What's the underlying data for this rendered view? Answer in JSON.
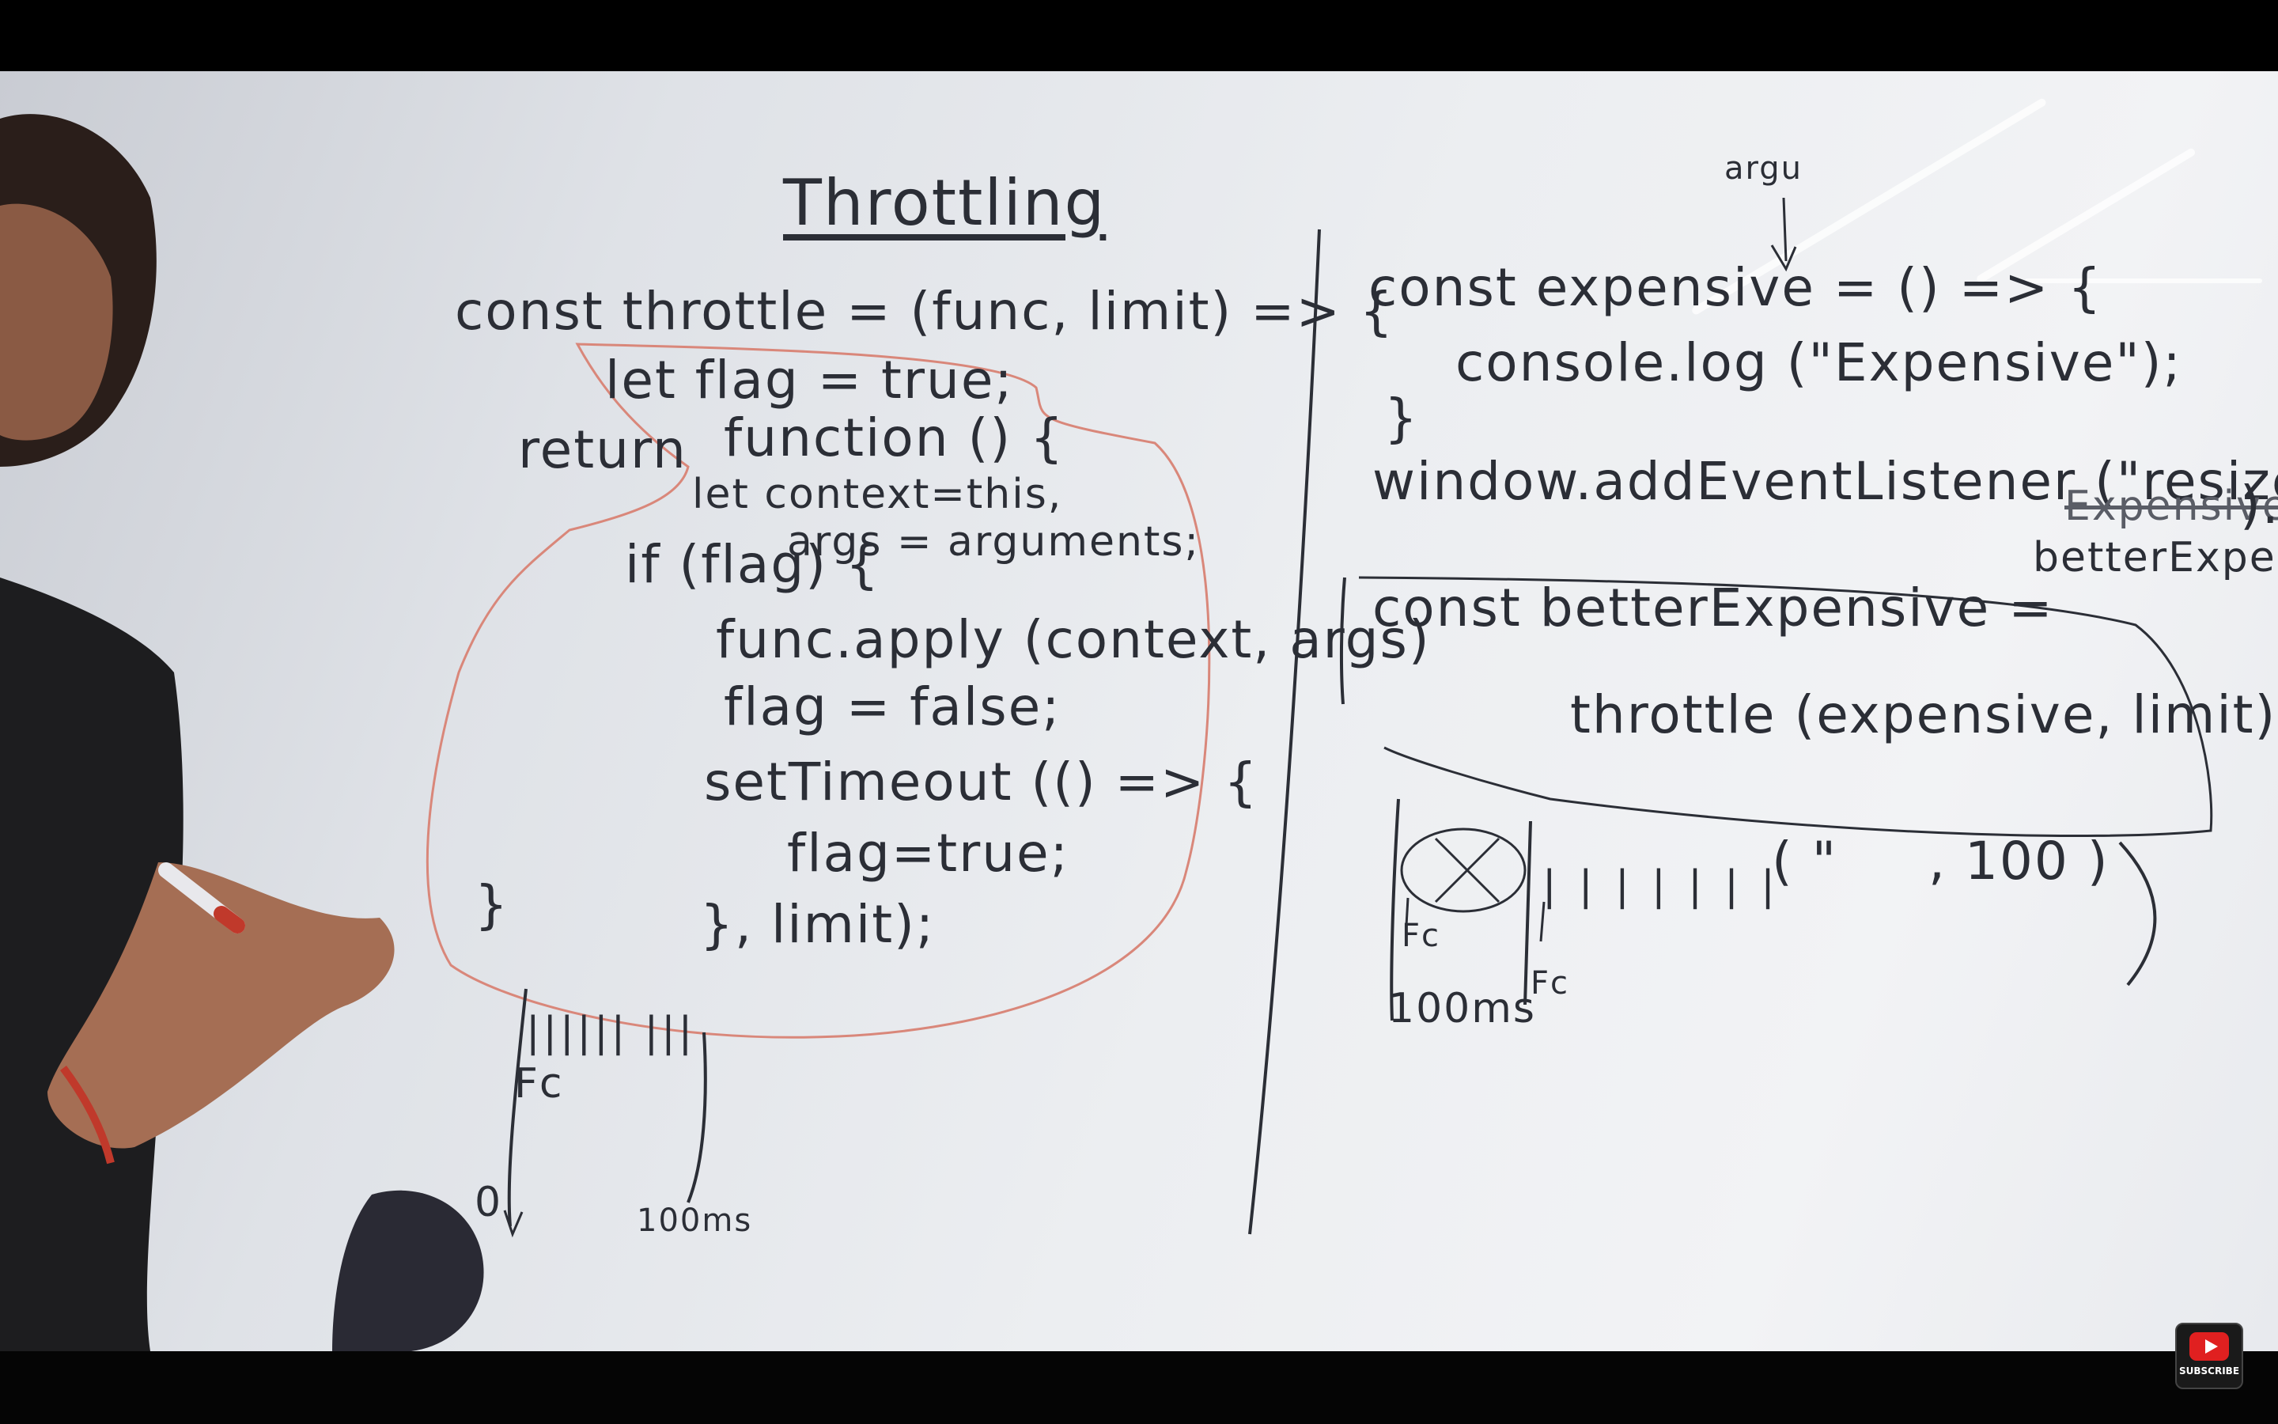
{
  "whiteboard": {
    "title": "Throttling",
    "left_code": [
      "const throttle = (func, limit) => {",
      "let flag = true;",
      "return",
      "function () {",
      "let context=this,",
      "args = arguments;",
      "if (flag) {",
      "func.apply (context, args)",
      "flag = false;",
      "setTimeout (() => {",
      "flag=true;",
      "}, limit);",
      "}"
    ],
    "left_timeline": {
      "ticks": "|||||| |||",
      "fc": "Fc",
      "start": "0",
      "end": "100ms"
    },
    "right_top_note": "argu",
    "right_code": [
      "const expensive = () => {",
      "console.log (\"Expensive\");",
      "}",
      "window.addEventListener (\"resize\",",
      "Expensive",
      ").",
      "betterExpensive"
    ],
    "right_boxed": [
      "const betterExpensive =",
      "throttle (expensive, limit);"
    ],
    "right_args_note": "( \"     , 100 )",
    "right_timeline": {
      "ticks": "| | | | | | |",
      "fc1": "Fc",
      "fc2": "Fc",
      "label": "100ms"
    }
  },
  "overlay": {
    "subscribe_label": "SUBSCRIBE",
    "subscribe_icon": "youtube-play-icon",
    "brand_color": "#e02020"
  }
}
